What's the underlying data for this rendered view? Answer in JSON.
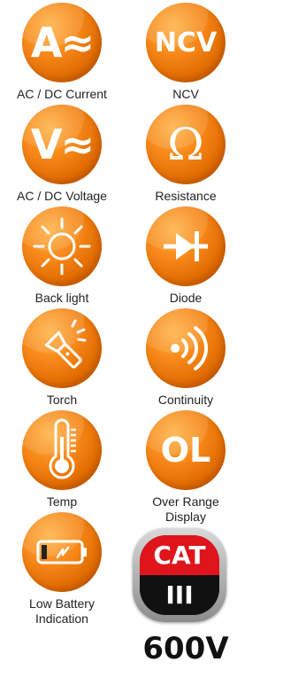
{
  "features": {
    "ac_dc_current": {
      "icon_text": "A≈",
      "label": "AC / DC Current",
      "icon": "ac-dc-current-icon"
    },
    "ncv": {
      "icon_text": "NCV",
      "label": "NCV",
      "icon": "ncv-icon"
    },
    "ac_dc_voltage": {
      "icon_text": "V≈",
      "label": "AC / DC Voltage",
      "icon": "ac-dc-voltage-icon"
    },
    "resistance": {
      "icon_text": "Ω",
      "label": "Resistance",
      "icon": "ohm-icon"
    },
    "back_light": {
      "label": "Back light",
      "icon": "sun-icon"
    },
    "diode": {
      "label": "Diode",
      "icon": "diode-icon"
    },
    "torch": {
      "label": "Torch",
      "icon": "flashlight-icon"
    },
    "continuity": {
      "label": "Continuity",
      "icon": "sound-waves-icon"
    },
    "temp": {
      "label": "Temp",
      "icon": "thermometer-icon"
    },
    "over_range": {
      "icon_text": "OL",
      "label_line1": "Over Range",
      "label_line2": "Display",
      "icon": "overload-icon"
    },
    "low_battery": {
      "label_line1": "Low Battery",
      "label_line2": "Indication",
      "icon": "battery-icon"
    }
  },
  "cat_badge": {
    "top": "CAT",
    "bottom": "III"
  },
  "voltage_rating": "600V",
  "colors": {
    "accent": "#f7861c",
    "cat_red": "#e0141b",
    "cat_black": "#111111"
  }
}
